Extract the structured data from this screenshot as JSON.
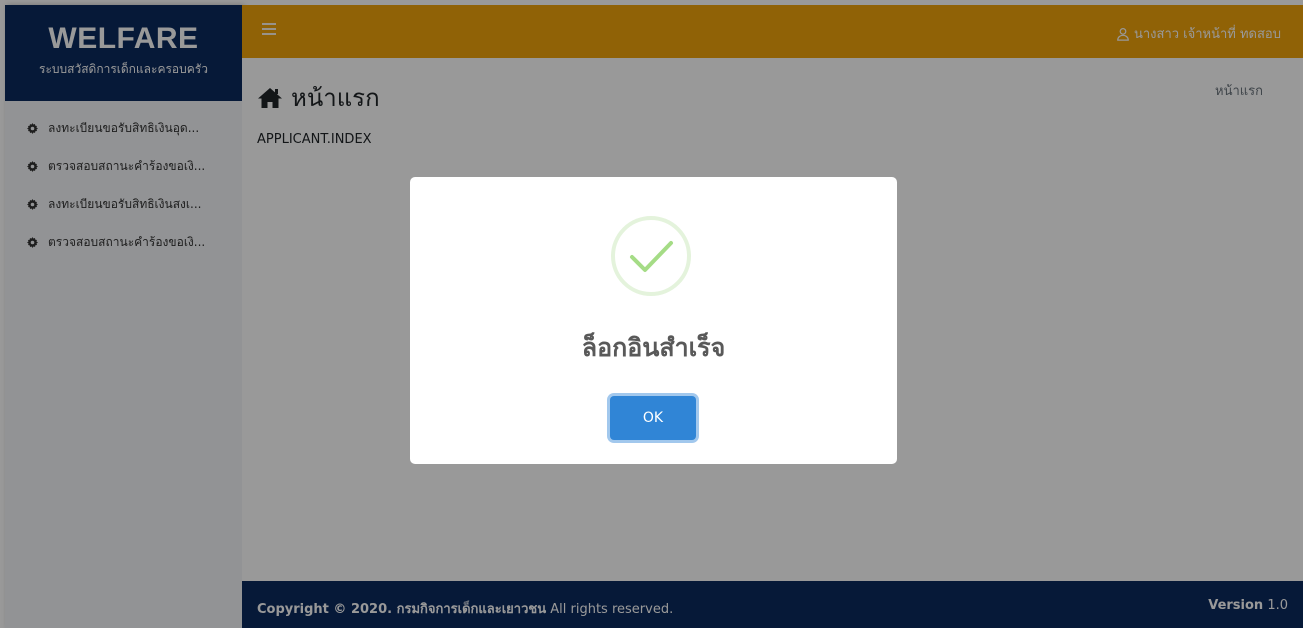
{
  "brand": {
    "title": "WELFARE",
    "subtitle": "ระบบสวัสดิการเด็กและครอบครัว"
  },
  "sidebar": {
    "items": [
      {
        "label": "ลงทะเบียนขอรับสิทธิเงินอุด...",
        "icon": "gear-icon"
      },
      {
        "label": "ตรวจสอบสถานะคำร้องขอเงิ...",
        "icon": "gear-icon"
      },
      {
        "label": "ลงทะเบียนขอรับสิทธิเงินสงเ...",
        "icon": "gear-icon"
      },
      {
        "label": "ตรวจสอบสถานะคำร้องขอเงิ...",
        "icon": "gear-icon"
      }
    ]
  },
  "header": {
    "menu_icon": "hamburger-icon",
    "user_icon": "user-icon",
    "user_name": "นางสาว เจ้าหน้าที่ ทดสอบ"
  },
  "content": {
    "title_icon": "home-icon",
    "title": "หน้าแรก",
    "breadcrumb": "หน้าแรก",
    "index_label": "APPLICANT.INDEX"
  },
  "footer": {
    "copyright_prefix": "Copyright © 2020. กรมกิจการเด็กและเยาวชน",
    "copyright_suffix": " All rights reserved.",
    "version_label": "Version",
    "version_number": " 1.0"
  },
  "modal": {
    "icon": "success-check-icon",
    "title": "ล็อกอินสำเร็จ",
    "ok_label": "OK"
  },
  "colors": {
    "brand_navy": "#0b2a5e",
    "header_orange": "#f0a30a",
    "ok_blue": "#3085d6",
    "success_green": "#a5dc86"
  }
}
